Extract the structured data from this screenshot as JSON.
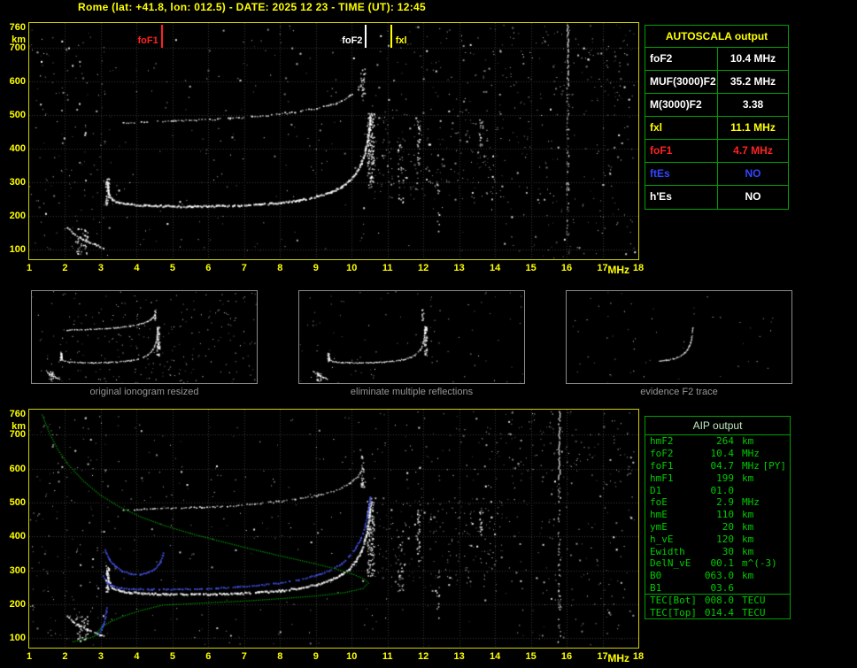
{
  "title": "Rome (lat: +41.8, lon: 012.5) - DATE: 2025 12 23 - TIME (UT): 12:45",
  "colors": {
    "background": "#000000",
    "plot_border": "#cfcf00",
    "axis_text": "#ffff00",
    "grid": "#3a3a3a",
    "table_border": "#00a000",
    "aip_text": "#00cc00",
    "caption_text": "#969696",
    "trace": "#ffffff",
    "profile": "#00bb00",
    "restored": "#4455ee",
    "red": "#ff2222",
    "blue": "#3344ff",
    "yellow": "#ffff00",
    "white": "#ffffff"
  },
  "autoscala": {
    "title": "AUTOSCALA output",
    "rows": [
      {
        "label": "foF2",
        "value": "10.4 MHz",
        "color": "#ffffff"
      },
      {
        "label": "MUF(3000)F2",
        "value": "35.2 MHz",
        "color": "#ffffff"
      },
      {
        "label": "M(3000)F2",
        "value": "3.38",
        "color": "#ffffff"
      },
      {
        "label": "fxl",
        "value": "11.1 MHz",
        "color": "#ffff00"
      },
      {
        "label": "foF1",
        "value": "4.7 MHz",
        "color": "#ff2222"
      },
      {
        "label": "ftEs",
        "value": "NO",
        "color": "#3344ff"
      },
      {
        "label": "h'Es",
        "value": "NO",
        "color": "#ffffff"
      }
    ]
  },
  "aip": {
    "title": "AIP output",
    "rows": [
      {
        "label": "hmF2",
        "value": "264",
        "unit": "km",
        "note": "",
        "separator": false
      },
      {
        "label": "foF2",
        "value": "10.4",
        "unit": "MHz",
        "note": "",
        "separator": false
      },
      {
        "label": "foF1",
        "value": "04.7",
        "unit": "MHz",
        "note": "[PY]",
        "separator": false
      },
      {
        "label": "hmF1",
        "value": "199",
        "unit": "km",
        "note": "",
        "separator": false
      },
      {
        "label": "D1",
        "value": "01.0",
        "unit": "",
        "note": "",
        "separator": false
      },
      {
        "label": "foE",
        "value": "2.9",
        "unit": "MHz",
        "note": "",
        "separator": false
      },
      {
        "label": "hmE",
        "value": "110",
        "unit": "km",
        "note": "",
        "separator": false
      },
      {
        "label": "ymE",
        "value": "20",
        "unit": "km",
        "note": "",
        "separator": false
      },
      {
        "label": "h_vE",
        "value": "120",
        "unit": "km",
        "note": "",
        "separator": false
      },
      {
        "label": "Ewidth",
        "value": "30",
        "unit": "km",
        "note": "",
        "separator": false
      },
      {
        "label": "DelN_vE",
        "value": "00.1",
        "unit": "m^(-3)",
        "note": "",
        "separator": false
      },
      {
        "label": "B0",
        "value": "063.0",
        "unit": "km",
        "note": "",
        "separator": false
      },
      {
        "label": "B1",
        "value": "03.6",
        "unit": "",
        "note": "",
        "separator": false
      },
      {
        "label": "TEC[Bot]",
        "value": "008.0",
        "unit": "TECU",
        "note": "",
        "separator": true
      },
      {
        "label": "TEC[Top]",
        "value": "014.4",
        "unit": "TECU",
        "note": "",
        "separator": false
      }
    ]
  },
  "thumbnails": [
    {
      "caption": "original ionogram resized",
      "seed": 11,
      "noise_n": 260,
      "traces": [
        "f2_trace",
        "second_hop",
        "e_trace"
      ],
      "show_smears": true
    },
    {
      "caption": "eliminate multiple reflections",
      "seed": 22,
      "noise_n": 90,
      "traces": [
        "f2_trace",
        "e_trace"
      ],
      "show_smears": true
    },
    {
      "caption": "evidence F2 trace",
      "seed": 33,
      "noise_n": 55,
      "traces": [
        "f2_tail"
      ],
      "show_smears": false
    }
  ],
  "chart_data": {
    "type": "scatter",
    "description": "Vertical-incidence ionograms: virtual height (km) vs sounding frequency (MHz); top = AUTOSCALA scaled ionogram, bottom = same ionogram with AIP restored trace (blue) and electron density profile (green)",
    "x_axis": {
      "label": "MHz",
      "range": [
        1,
        18
      ],
      "ticks": [
        1,
        2,
        3,
        4,
        5,
        6,
        7,
        8,
        9,
        10,
        11,
        12,
        13,
        14,
        15,
        16,
        17,
        18
      ]
    },
    "y_axis": {
      "label": "km",
      "range_km": [
        72,
        774
      ],
      "tick_km": [
        760,
        700,
        600,
        500,
        400,
        300,
        200,
        100
      ],
      "grid_km": [
        100,
        200,
        300,
        400,
        500,
        600,
        700
      ]
    },
    "markers": [
      {
        "text": "foF1",
        "mhz": 4.7,
        "color": "#ff2222",
        "label_side": "left"
      },
      {
        "text": "foF2",
        "mhz": 10.4,
        "color": "#ffffff",
        "label_side": "left"
      },
      {
        "text": "fxl",
        "mhz": 11.1,
        "color": "#ffff00",
        "label_side": "right"
      }
    ],
    "scaled_values": {
      "foF2_MHz": 10.4,
      "MUF3000F2_MHz": 35.2,
      "M3000F2": 3.38,
      "fxl_MHz": 11.1,
      "foF1_MHz": 4.7,
      "ftEs": "NO",
      "hEs": "NO"
    },
    "traces": {
      "f2_trace": [
        [
          3.15,
          302
        ],
        [
          3.2,
          268
        ],
        [
          3.3,
          250
        ],
        [
          3.5,
          242
        ],
        [
          3.8,
          237
        ],
        [
          4.2,
          234
        ],
        [
          4.8,
          232
        ],
        [
          5.5,
          231
        ],
        [
          6.2,
          232
        ],
        [
          6.8,
          234
        ],
        [
          7.4,
          237
        ],
        [
          8.0,
          242
        ],
        [
          8.5,
          249
        ],
        [
          9.0,
          260
        ],
        [
          9.4,
          273
        ],
        [
          9.7,
          289
        ],
        [
          9.9,
          306
        ],
        [
          10.1,
          330
        ],
        [
          10.25,
          358
        ],
        [
          10.35,
          390
        ],
        [
          10.42,
          425
        ],
        [
          10.47,
          462
        ],
        [
          10.5,
          500
        ]
      ],
      "second_hop": [
        [
          3.6,
          479
        ],
        [
          4.2,
          482
        ],
        [
          5.0,
          485
        ],
        [
          5.8,
          488
        ],
        [
          6.6,
          492
        ],
        [
          7.2,
          497
        ],
        [
          7.8,
          503
        ],
        [
          8.4,
          511
        ],
        [
          9.0,
          522
        ],
        [
          9.4,
          533
        ],
        [
          9.7,
          546
        ],
        [
          9.95,
          560
        ],
        [
          10.15,
          578
        ],
        [
          10.28,
          600
        ]
      ],
      "e_trace": [
        [
          2.05,
          168
        ],
        [
          2.2,
          152
        ],
        [
          2.4,
          138
        ],
        [
          2.6,
          127
        ],
        [
          2.8,
          118
        ],
        [
          2.95,
          112
        ],
        [
          3.05,
          108
        ]
      ],
      "f2_tail_min_mhz": 7.6
    },
    "smears": [
      {
        "mhz": 3.17,
        "km": [
          238,
          315
        ],
        "n": 42,
        "w": 4
      },
      {
        "mhz": 10.52,
        "km": [
          285,
          510
        ],
        "n": 130,
        "w": 8
      },
      {
        "mhz": 10.3,
        "km": [
          545,
          640
        ],
        "n": 30,
        "w": 5
      },
      {
        "mhz": 2.45,
        "km": [
          88,
          165
        ],
        "n": 45,
        "w": 14
      }
    ],
    "rfi_smears": [
      {
        "mhz": 11.85,
        "km": [
          350,
          485
        ],
        "n": 28,
        "w": 4
      },
      {
        "mhz": 13.6,
        "km": [
          405,
          490
        ],
        "n": 20,
        "w": 4
      },
      {
        "mhz": 12.4,
        "km": [
          150,
          300
        ],
        "n": 12,
        "w": 3
      },
      {
        "mhz": 11.35,
        "km": [
          240,
          420
        ],
        "n": 26,
        "w": 6
      }
    ],
    "noise_regions": [
      {
        "x": [
          1.0,
          3.2
        ],
        "km": [
          80,
          768
        ],
        "n": 130
      },
      {
        "x": [
          3.2,
          10.5
        ],
        "km": [
          80,
          768
        ],
        "n": 110
      },
      {
        "x": [
          10.6,
          14.2
        ],
        "km": [
          250,
          520
        ],
        "n": 230
      },
      {
        "x": [
          10.6,
          17.9
        ],
        "km": [
          540,
          770
        ],
        "n": 150
      },
      {
        "x": [
          14.2,
          17.9
        ],
        "km": [
          80,
          768
        ],
        "n": 190
      },
      {
        "x": [
          1.0,
          17.9
        ],
        "km": [
          72,
          770
        ],
        "n": 150
      }
    ],
    "ionogram_top": {
      "seed": 417,
      "rfi_column": {
        "mhz": 16.02,
        "solid_km": [
          590,
          770
        ],
        "sparse_km": [
          90,
          590
        ]
      }
    },
    "ionogram_bottom": {
      "seed": 909,
      "rfi_column": {
        "mhz": 15.78,
        "solid_km": [
          570,
          770
        ],
        "sparse_km": [
          90,
          570
        ]
      },
      "profile_green": [
        [
          1.35,
          760
        ],
        [
          1.55,
          706
        ],
        [
          1.8,
          655
        ],
        [
          2.1,
          610
        ],
        [
          2.5,
          565
        ],
        [
          2.95,
          525
        ],
        [
          3.5,
          489
        ],
        [
          4.1,
          459
        ],
        [
          4.8,
          432
        ],
        [
          5.6,
          407
        ],
        [
          6.4,
          385
        ],
        [
          7.2,
          364
        ],
        [
          8.0,
          344
        ],
        [
          8.8,
          325
        ],
        [
          9.5,
          307
        ],
        [
          10.05,
          289
        ],
        [
          10.35,
          275
        ],
        [
          10.45,
          264
        ],
        [
          10.3,
          248
        ],
        [
          9.8,
          236
        ],
        [
          9.0,
          226
        ],
        [
          8.0,
          218
        ],
        [
          7.0,
          211
        ],
        [
          6.0,
          206
        ],
        [
          5.3,
          202
        ],
        [
          4.7,
          199
        ],
        [
          4.1,
          183
        ],
        [
          3.6,
          166
        ],
        [
          3.25,
          150
        ],
        [
          3.0,
          134
        ],
        [
          2.9,
          120
        ],
        [
          2.88,
          111
        ],
        [
          2.7,
          103
        ],
        [
          2.45,
          96
        ],
        [
          2.15,
          90
        ]
      ],
      "restored_blue": {
        "main": [
          [
            3.05,
            285
          ],
          [
            3.15,
            266
          ],
          [
            3.3,
            256
          ],
          [
            3.55,
            250
          ],
          [
            3.9,
            247
          ],
          [
            4.4,
            246
          ],
          [
            5.0,
            246
          ],
          [
            5.6,
            247
          ],
          [
            6.2,
            249
          ],
          [
            6.8,
            253
          ],
          [
            7.4,
            258
          ],
          [
            8.0,
            265
          ],
          [
            8.5,
            274
          ],
          [
            9.0,
            288
          ],
          [
            9.4,
            303
          ],
          [
            9.7,
            321
          ],
          [
            9.9,
            342
          ],
          [
            10.1,
            368
          ],
          [
            10.25,
            398
          ],
          [
            10.35,
            430
          ],
          [
            10.42,
            462
          ],
          [
            10.47,
            492
          ],
          [
            10.5,
            518
          ]
        ],
        "cusp": [
          [
            3.1,
            362
          ],
          [
            3.22,
            333
          ],
          [
            3.38,
            314
          ],
          [
            3.58,
            300
          ],
          [
            3.82,
            292
          ],
          [
            4.08,
            290
          ],
          [
            4.3,
            295
          ],
          [
            4.5,
            307
          ],
          [
            4.64,
            326
          ],
          [
            4.72,
            352
          ]
        ],
        "e_cusp": [
          [
            2.92,
            116
          ],
          [
            3.0,
            128
          ],
          [
            3.06,
            145
          ],
          [
            3.11,
            166
          ],
          [
            3.15,
            192
          ]
        ]
      }
    }
  }
}
